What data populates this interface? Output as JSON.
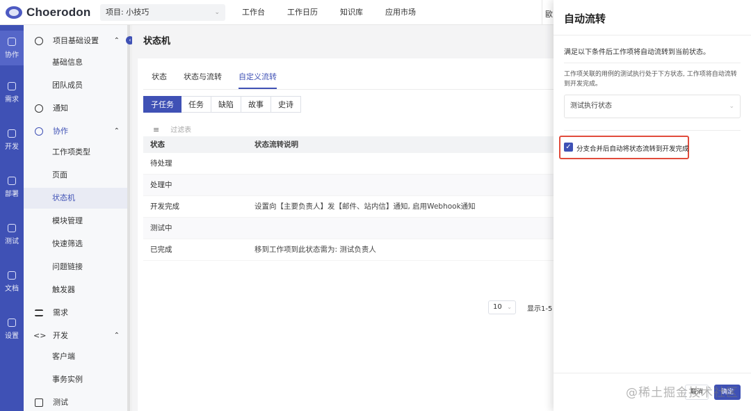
{
  "header": {
    "logo_text": "Choerodon",
    "project_select": "项目: 小技巧",
    "nav": [
      "工作台",
      "工作日历",
      "知识库",
      "应用市场"
    ],
    "cut_text": "歐"
  },
  "rail": {
    "items": [
      {
        "label": "协作",
        "icon": "collab-icon"
      },
      {
        "label": "需求",
        "icon": "layers-icon"
      },
      {
        "label": "开发",
        "icon": "code-icon"
      },
      {
        "label": "部署",
        "icon": "deploy-icon"
      },
      {
        "label": "测试",
        "icon": "clipboard-icon"
      },
      {
        "label": "文档",
        "icon": "doc-icon"
      },
      {
        "label": "设置",
        "icon": "settings-icon"
      }
    ]
  },
  "menu": {
    "project_settings": "项目基础设置",
    "basic_info": "基础信息",
    "team_members": "团队成员",
    "notify": "通知",
    "collab": "协作",
    "issue_types": "工作项类型",
    "page": "页面",
    "state_machine": "状态机",
    "modules": "模块管理",
    "quick_filter": "快速筛选",
    "issue_links": "问题链接",
    "triggers": "触发器",
    "demand": "需求",
    "develop": "开发",
    "client": "客户端",
    "tx_instance": "事务实例",
    "test": "测试"
  },
  "main": {
    "page_title": "状态机",
    "tabs": [
      "状态",
      "状态与流转",
      "自定义流转"
    ],
    "segments": [
      "子任务",
      "任务",
      "缺陷",
      "故事",
      "史诗"
    ],
    "filter_placeholder": "过滤表",
    "table": {
      "headers": [
        "状态",
        "状态流转说明"
      ],
      "rows": [
        [
          "待处理",
          ""
        ],
        [
          "处理中",
          ""
        ],
        [
          "开发完成",
          "设置向【主要负责人】发【邮件、站内信】通知, 启用Webhook通知"
        ],
        [
          "测试中",
          ""
        ],
        [
          "已完成",
          "移到工作项到此状态需为: 测试负责人"
        ]
      ]
    },
    "page_size": "10",
    "page_info": "显示1-5"
  },
  "drawer": {
    "title": "自动流转",
    "desc": "满足以下条件后工作项将自动流转到当前状态。",
    "note": "工作项关联的用例的测试执行处于下方状态, 工作项将自动流转到开发完成。",
    "select_value": "测试执行状态",
    "checkbox_label": "分支合并后自动将状态流转到开发完成",
    "cancel": "取消",
    "ok": "确定"
  },
  "watermark": "@稀土掘金技术社区",
  "colors": {
    "primary": "#3f51b5",
    "highlight": "#e14b3b"
  }
}
